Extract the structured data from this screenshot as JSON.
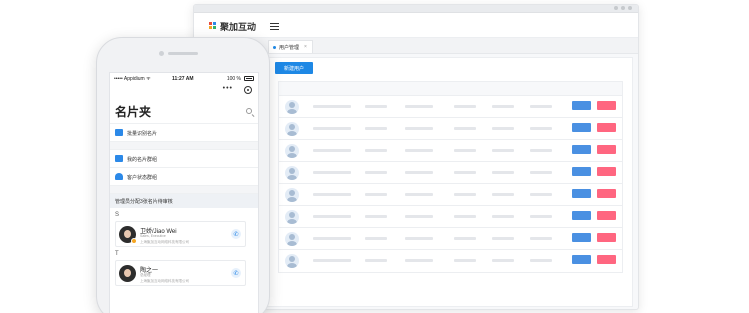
{
  "browser": {
    "logo_text": "聚加互动",
    "tab_label": "用户管理",
    "tab_close": "×",
    "add_user_label": "新建用户",
    "row_count": 8,
    "colors": {
      "primary": "#1e88e5",
      "edit": "#4a90e2",
      "delete": "#ff6680"
    }
  },
  "phone": {
    "status": {
      "carrier": "••••• Appidium ᯤ",
      "time": "11:27 AM",
      "battery": "100 %"
    },
    "nav": {
      "more": "•••"
    },
    "page_title": "名片夹",
    "menu": [
      {
        "label": "批量识别名片",
        "icon": "camera-icon"
      },
      {
        "label": "我的名片群组",
        "icon": "card-group-icon"
      },
      {
        "label": "客户状态群组",
        "icon": "contacts-icon"
      }
    ],
    "group_header": "管理员分配3张名片待审核",
    "sections": [
      {
        "letter": "S",
        "contact": {
          "name": "卫娇/Jiao Wei",
          "title": "Sales, Executive",
          "company": "上海聚加互动网络科技有限公司"
        }
      },
      {
        "letter": "T",
        "contact": {
          "name": "陶之一",
          "title": "总经理",
          "company": "上海聚加互动网络科技有限公司"
        }
      }
    ]
  }
}
